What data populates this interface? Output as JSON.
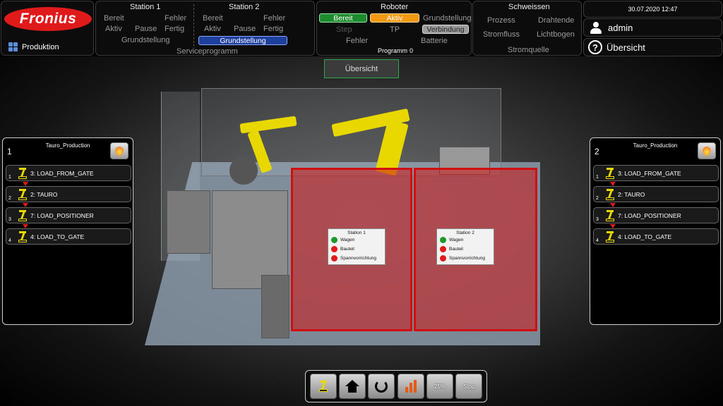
{
  "brand": {
    "logo_text": "Fronius",
    "production_label": "Produktion"
  },
  "stations": {
    "station1": {
      "title": "Station 1",
      "bereit": "Bereit",
      "fehler": "Fehler",
      "aktiv": "Aktiv",
      "pause": "Pause",
      "fertig": "Fertig",
      "grundstellung": "Grundstellung"
    },
    "station2": {
      "title": "Station 2",
      "bereit": "Bereit",
      "fehler": "Fehler",
      "aktiv": "Aktiv",
      "pause": "Pause",
      "fertig": "Fertig",
      "grundstellung": "Grundstellung"
    },
    "service_label": "Serviceprogramm"
  },
  "robot": {
    "title": "Roboter",
    "bereit": "Bereit",
    "aktiv": "Aktiv",
    "grundstellung": "Grundstellung",
    "step": "Step",
    "tp": "TP",
    "verbindung": "Verbindung",
    "fehler": "Fehler",
    "programm_label": "Programm",
    "programm_value": "0",
    "batterie": "Batterie"
  },
  "welding": {
    "title": "Schweissen",
    "prozess": "Prozess",
    "drahtende": "Drahtende",
    "stromfluss": "Stromfluss",
    "lichtbogen": "Lichtbogen",
    "stromquelle": "Stromquelle"
  },
  "header": {
    "datetime": "30.07.2020 12:47",
    "user": "admin",
    "overview": "Übersicht"
  },
  "view": {
    "overview_button": "Übersicht"
  },
  "programs": {
    "left": {
      "number": "1",
      "title": "Tauro_Production",
      "steps": [
        {
          "index": "1",
          "label": "3: LOAD_FROM_GATE"
        },
        {
          "index": "2",
          "label": "2: TAURO"
        },
        {
          "index": "3",
          "label": "7: LOAD_POSITIONER"
        },
        {
          "index": "4",
          "label": "4: LOAD_TO_GATE"
        }
      ]
    },
    "right": {
      "number": "2",
      "title": "Tauro_Production",
      "steps": [
        {
          "index": "1",
          "label": "3: LOAD_FROM_GATE"
        },
        {
          "index": "2",
          "label": "2: TAURO"
        },
        {
          "index": "3",
          "label": "7: LOAD_POSITIONER"
        },
        {
          "index": "4",
          "label": "4: LOAD_TO_GATE"
        }
      ]
    }
  },
  "scene": {
    "station1_card": {
      "title": "Station 1",
      "rows": [
        "Wagen",
        "Bauteil",
        "Spannvorrichtung"
      ],
      "states": [
        "green",
        "red",
        "red"
      ]
    },
    "station2_card": {
      "title": "Station 2",
      "rows": [
        "Wagen",
        "Bauteil",
        "Spannvorrichtung"
      ],
      "states": [
        "green",
        "red",
        "red"
      ]
    }
  },
  "toolbar": {
    "speed": "25%",
    "stop": "Stop"
  },
  "colors": {
    "accent_red": "#e01a1a",
    "ready_green": "#1e8a2e",
    "active_orange": "#f39a14",
    "select_blue": "#1f3f9c",
    "robot_yellow": "#e8d800"
  }
}
